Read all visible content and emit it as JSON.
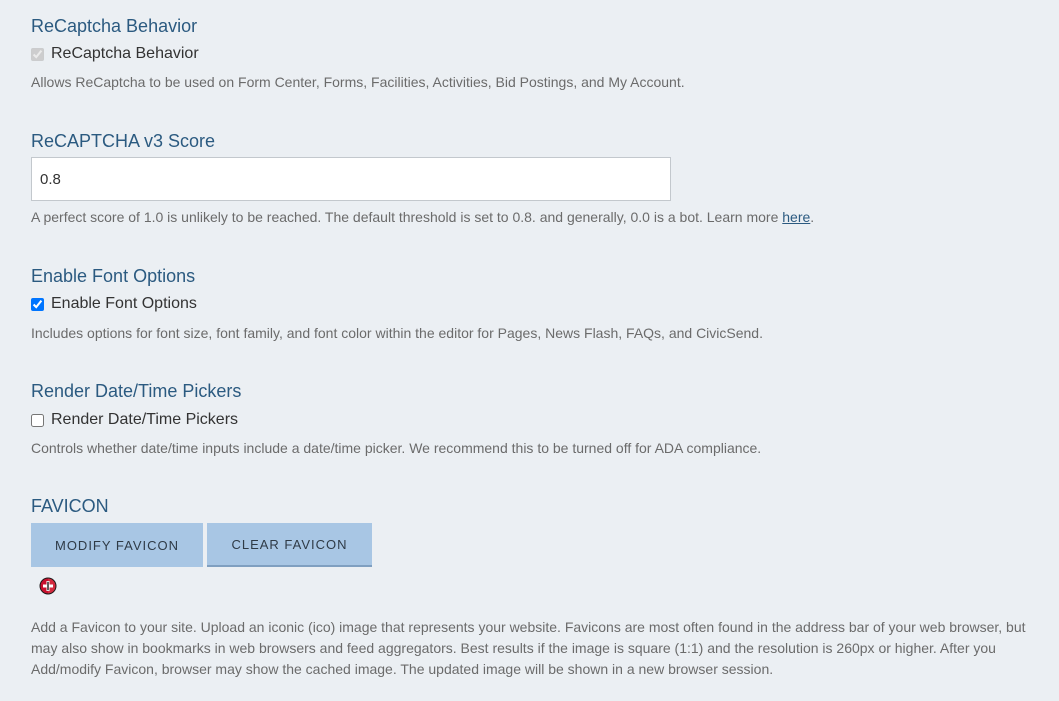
{
  "recaptcha": {
    "title": "ReCaptcha Behavior",
    "checkbox_label": "ReCaptcha Behavior",
    "checked": true,
    "disabled": true,
    "help": "Allows ReCaptcha to be used on Form Center, Forms, Facilities, Activities, Bid Postings, and My Account."
  },
  "recaptcha_v3": {
    "title": "ReCAPTCHA v3 Score",
    "value": "0.8",
    "help_prefix": "A perfect score of 1.0 is unlikely to be reached. The default threshold is set to 0.8. and generally, 0.0 is a bot. Learn more ",
    "help_link": "here",
    "help_suffix": "."
  },
  "font_options": {
    "title": "Enable Font Options",
    "checkbox_label": "Enable Font Options",
    "checked": true,
    "help": "Includes options for font size, font family, and font color within the editor for Pages, News Flash, FAQs, and CivicSend."
  },
  "date_pickers": {
    "title": "Render Date/Time Pickers",
    "checkbox_label": "Render Date/Time Pickers",
    "checked": false,
    "help": "Controls whether date/time inputs include a date/time picker. We recommend this to be turned off for ADA compliance."
  },
  "favicon": {
    "title": "FAVICON",
    "modify_label": "MODIFY FAVICON",
    "clear_label": "CLEAR FAVICON",
    "icon": "favicon-logo-icon",
    "icon_color": "#c8102e",
    "help": "Add a Favicon to your site. Upload an iconic (ico) image that represents your website. Favicons are most often found in the address bar of your web browser, but may also show in bookmarks in web browsers and feed aggregators. Best results if the image is square (1:1) and the resolution is 260px or higher. After you Add/modify Favicon, browser may show the cached image. The updated image will be shown in a new browser session."
  }
}
